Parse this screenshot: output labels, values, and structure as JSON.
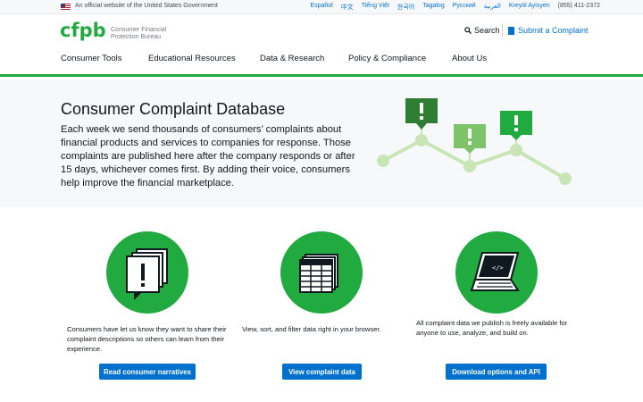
{
  "gov_banner": {
    "text": "An official website of the United States Government",
    "languages": [
      "Español",
      "中文",
      "Tiếng Việt",
      "한국어",
      "Tagalog",
      "Русский",
      "العربية",
      "Kreyòl Ayisyen"
    ],
    "phone": "(855) 411-2372"
  },
  "header": {
    "logo_mark": "cfpb",
    "logo_line1": "Consumer Financial",
    "logo_line2": "Protection Bureau",
    "search_label": "Search",
    "submit_label": "Submit a Complaint"
  },
  "nav": {
    "items": [
      "Consumer Tools",
      "Educational Resources",
      "Data & Research",
      "Policy & Compliance",
      "About Us"
    ]
  },
  "hero": {
    "title": "Consumer Complaint Database",
    "body": "Each week we send thousands of consumers’ complaints about financial products and services to companies for response. Those complaints are published here after the company responds or after 15 days, whichever comes first. By adding their voice, consumers help improve the financial marketplace."
  },
  "cards": [
    {
      "icon": "speech-bubbles-icon",
      "text": "Consumers have let us know they want to share their complaint descriptions so others can learn from their experience.",
      "button": "Read consumer narratives"
    },
    {
      "icon": "data-table-icon",
      "text": "View, sort, and filter data right in your browser.",
      "button": "View complaint data"
    },
    {
      "icon": "laptop-code-icon",
      "text": "All complaint data we publish is freely available for anyone to use, analyze, and build on.",
      "button": "Download options and API"
    }
  ],
  "colors": {
    "brand_green": "#20aa3f",
    "dark_green": "#2e7d32",
    "light_green": "#c7e5b5",
    "link_blue": "#0072ce",
    "hero_bg": "#f7f8f9"
  }
}
